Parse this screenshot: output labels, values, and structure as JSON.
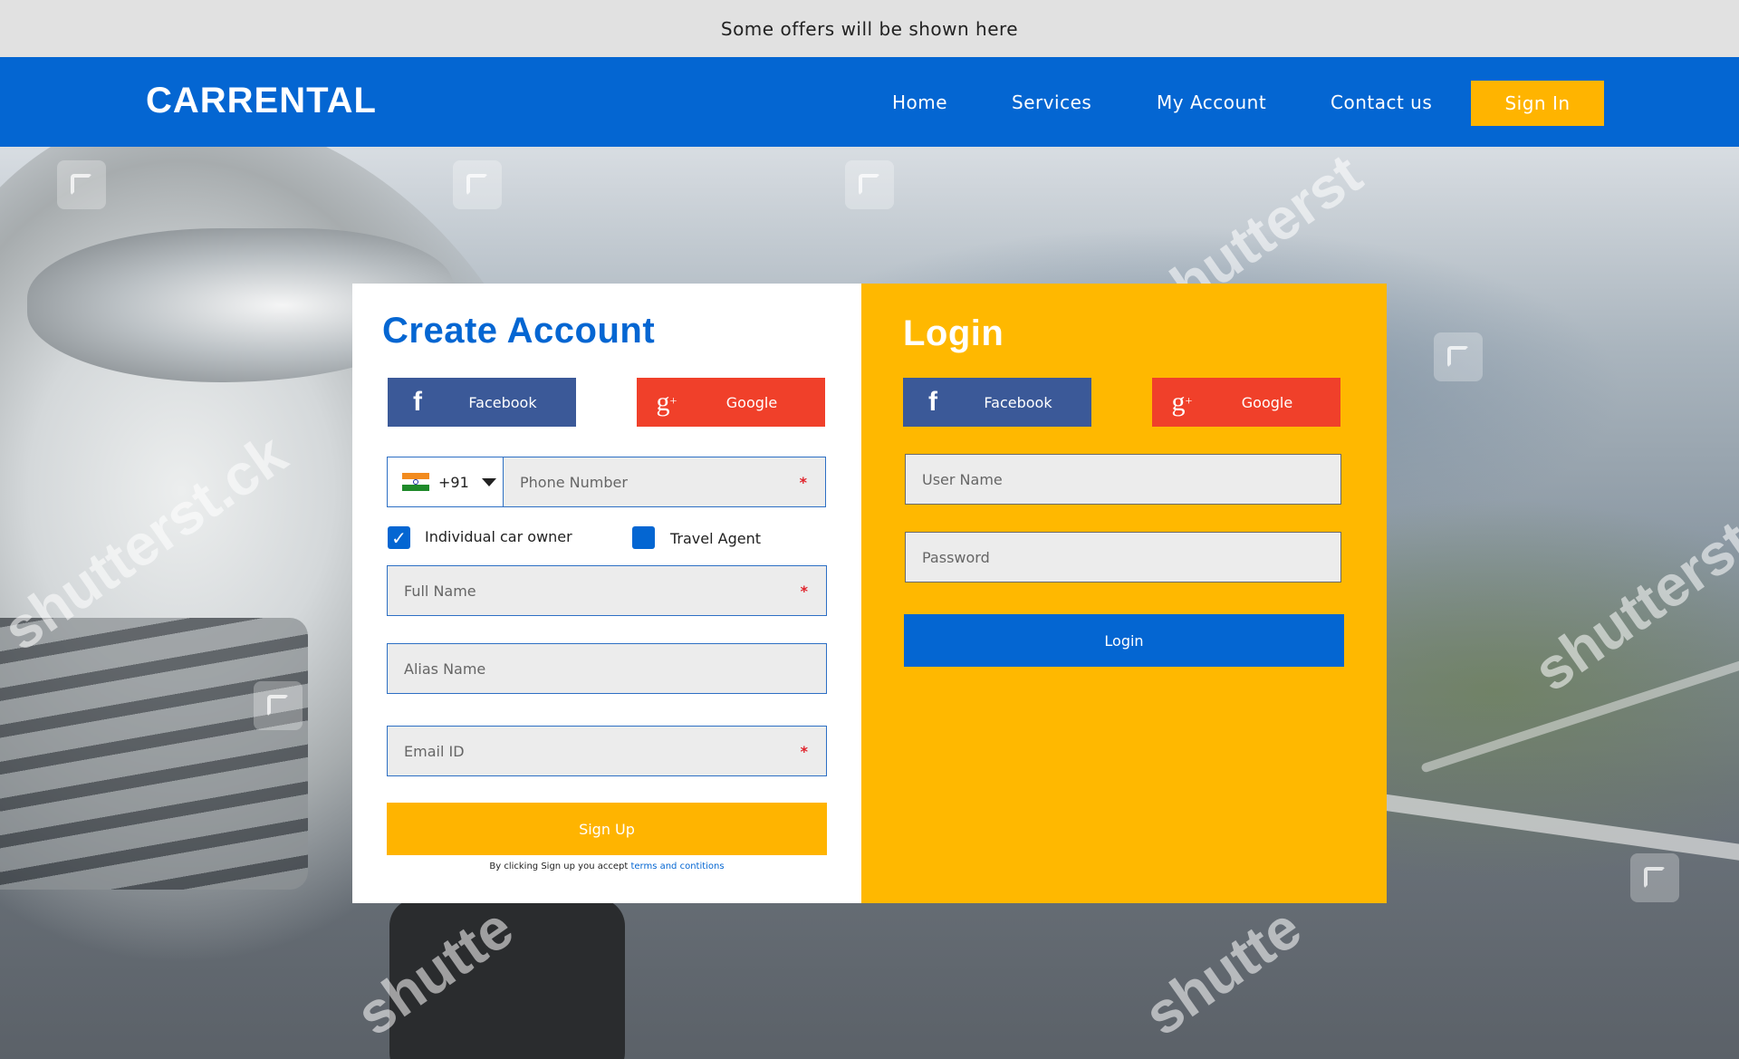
{
  "offer_bar": {
    "text": "Some offers will be shown here"
  },
  "header": {
    "logo": "CARRENTAL",
    "nav": [
      "Home",
      "Services",
      "My Account",
      "Contact us"
    ],
    "signin_label": "Sign In"
  },
  "watermark": {
    "text": "shutterstock",
    "partials": [
      "shutterst",
      "shutterst.ck",
      "shutterst",
      "shutte",
      "shutte"
    ]
  },
  "create_account": {
    "title": "Create Account",
    "facebook_label": "Facebook",
    "google_label": "Google",
    "phone": {
      "country_code": "+91",
      "placeholder": "Phone Number",
      "required_mark": "*"
    },
    "options": [
      {
        "label": "Individual car owner",
        "checked": true
      },
      {
        "label": "Travel Agent",
        "checked": false
      }
    ],
    "full_name": {
      "placeholder": "Full Name",
      "required_mark": "*"
    },
    "alias_name": {
      "placeholder": "Alias Name"
    },
    "email": {
      "placeholder": "Email ID",
      "required_mark": "*"
    },
    "signup_label": "Sign Up",
    "terms_prefix": "By clicking Sign up you accept ",
    "terms_link": "terms and contitions"
  },
  "login": {
    "title": "Login",
    "facebook_label": "Facebook",
    "google_label": "Google",
    "username_placeholder": "User Name",
    "password_placeholder": "Password",
    "login_label": "Login"
  },
  "colors": {
    "brand_blue": "#0466d2",
    "accent_yellow": "#ffb400",
    "facebook": "#3b5998",
    "google": "#f0402a"
  },
  "icons": [
    "facebook-icon",
    "google-plus-icon",
    "india-flag-icon",
    "chevron-down-icon",
    "check-icon"
  ]
}
